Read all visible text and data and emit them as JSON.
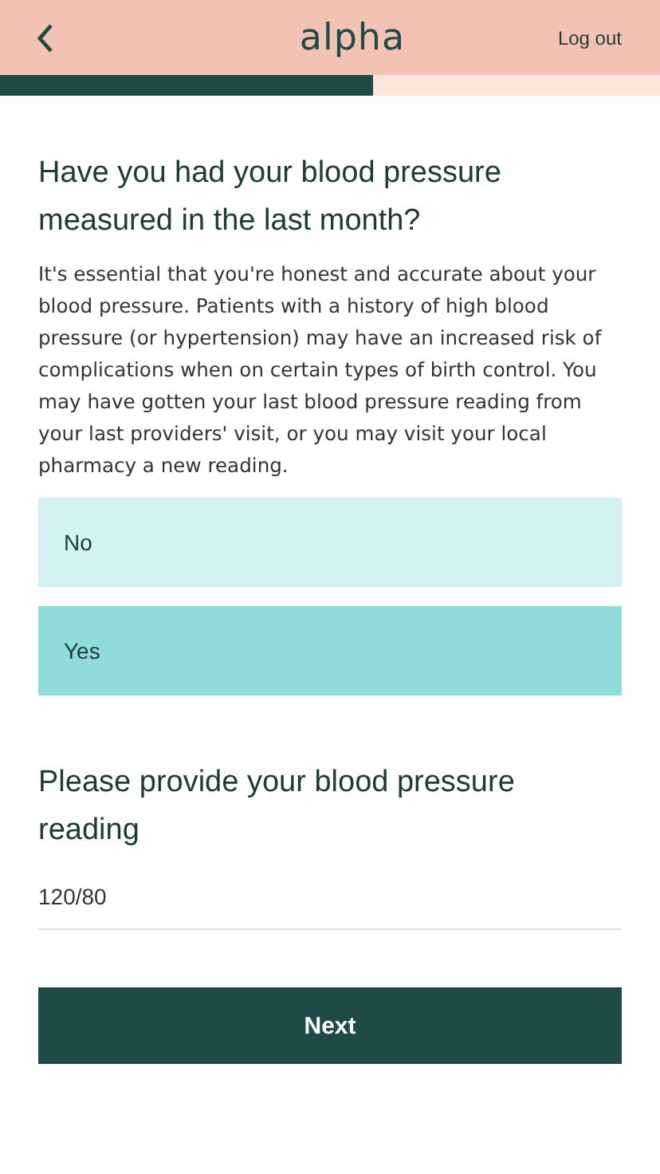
{
  "header": {
    "logo": "alpha",
    "logout": "Log out"
  },
  "progress": {
    "level": 0.565
  },
  "question": {
    "title": "Have you had your blood pressure measured in the last month?",
    "description": "It's essential that you're honest and accurate about your blood pressure. Patients with a history of high blood pressure (or hypertension) may have an increased risk of complications when on certain types of birth control. You may have gotten your last blood pressure reading from your last providers' visit, or you may visit your local pharmacy a new reading.",
    "options": [
      {
        "label": "No",
        "selected": false
      },
      {
        "label": "Yes",
        "selected": true
      }
    ]
  },
  "reading": {
    "title": "Please provide your blood pressure reading",
    "value": "120/80"
  },
  "next_button": "Next"
}
